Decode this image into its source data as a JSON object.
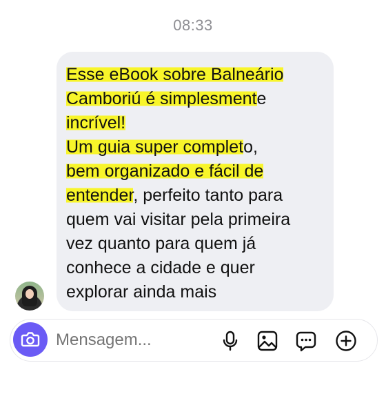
{
  "status": {
    "time": "08:33"
  },
  "message": {
    "lines": [
      [
        {
          "text": "Esse eBook sobre Balneário",
          "hl": true
        }
      ],
      [
        {
          "text": "Camboriú é simplesment",
          "hl": true
        },
        {
          "text": "e",
          "hl": false
        }
      ],
      [
        {
          "text": "incrível!",
          "hl": true
        }
      ],
      [
        {
          "text": " Um guia super complet",
          "hl": true
        },
        {
          "text": "o,",
          "hl": false
        }
      ],
      [
        {
          "text": "bem organizado e fácil de",
          "hl": true
        }
      ],
      [
        {
          "text": "entender",
          "hl": true
        },
        {
          "text": ", perfeito tanto para",
          "hl": false
        }
      ],
      [
        {
          "text": "quem vai visitar pela primeira",
          "hl": false
        }
      ],
      [
        {
          "text": "vez quanto para quem já",
          "hl": false
        }
      ],
      [
        {
          "text": "conhece a cidade e quer",
          "hl": false
        }
      ],
      [
        {
          "text": "explorar ainda mais",
          "hl": false
        }
      ]
    ]
  },
  "composer": {
    "placeholder": "Mensagem...",
    "icons": [
      "camera-icon",
      "microphone-icon",
      "image-icon",
      "sticker-chat-icon",
      "plus-icon"
    ],
    "accent_color": "#6b5bf5"
  },
  "colors": {
    "highlight": "#f8f52a",
    "bubble_bg": "#eeeff3"
  }
}
